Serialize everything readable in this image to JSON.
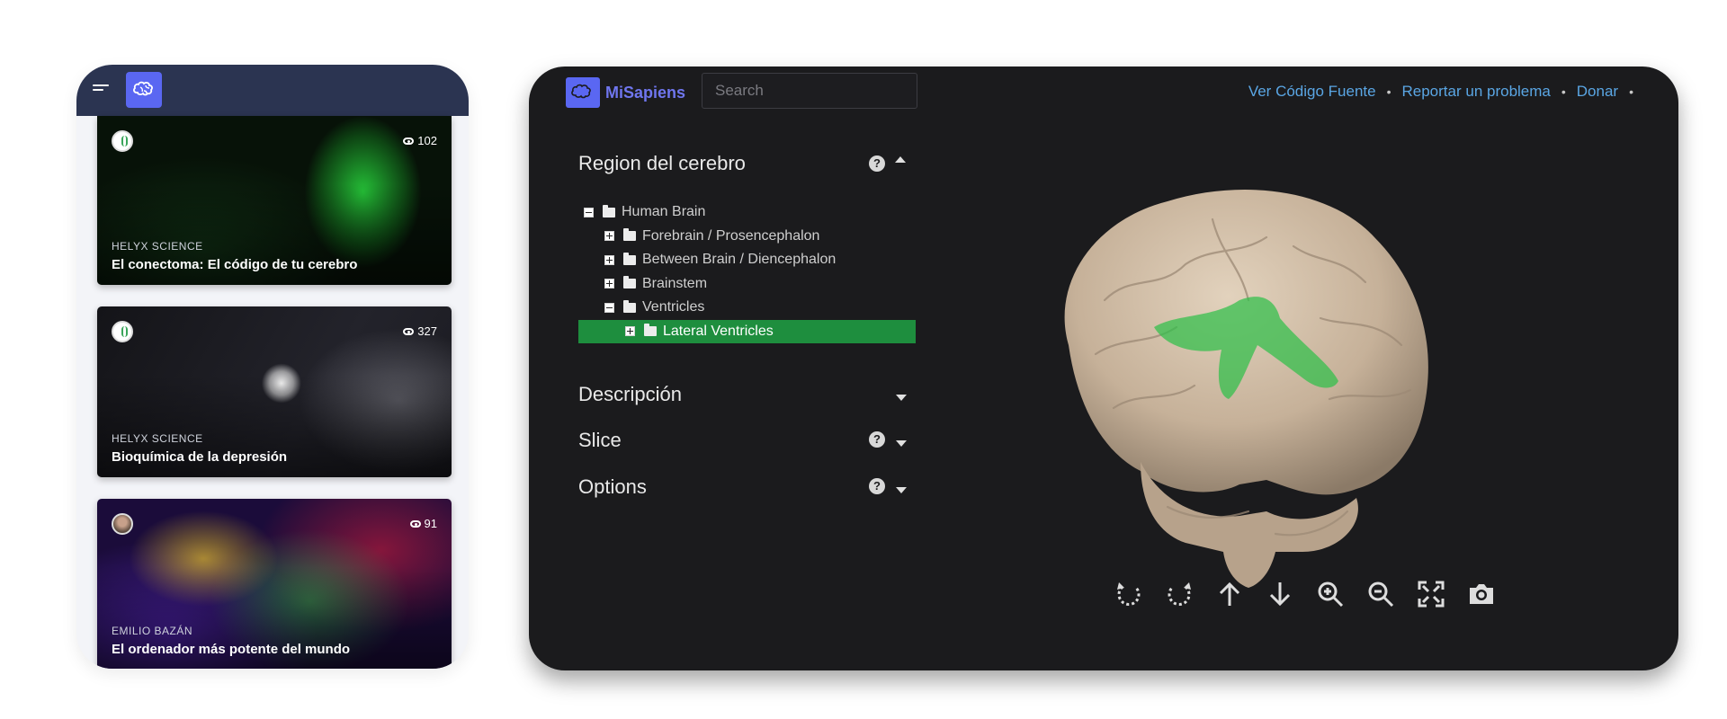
{
  "mobile": {
    "cards": [
      {
        "author": "HELYX SCIENCE",
        "title": "El conectoma: El código de tu cerebro",
        "views": "102",
        "avatar_icon": "dna-icon"
      },
      {
        "author": "HELYX SCIENCE",
        "title": "Bioquímica de la depresión",
        "views": "327",
        "avatar_icon": "dna-icon"
      },
      {
        "author": "EMILIO BAZÁN",
        "title": "El ordenador más potente del mundo",
        "views": "91",
        "avatar_icon": "user-photo"
      }
    ]
  },
  "app": {
    "brand": "MiSapiens",
    "search": {
      "placeholder": "Search",
      "value": ""
    },
    "nav": [
      "Ver Código Fuente",
      "Reportar un problema",
      "Donar"
    ],
    "panels": {
      "region": "Region del cerebro",
      "description": "Descripción",
      "slice": "Slice",
      "options": "Options"
    },
    "tree": [
      {
        "label": "Human Brain",
        "level": 0,
        "toggle": "minus"
      },
      {
        "label": "Forebrain / Prosencephalon",
        "level": 1,
        "toggle": "plus"
      },
      {
        "label": "Between Brain / Diencephalon",
        "level": 1,
        "toggle": "plus"
      },
      {
        "label": "Brainstem",
        "level": 1,
        "toggle": "plus"
      },
      {
        "label": "Ventricles",
        "level": 1,
        "toggle": "minus"
      },
      {
        "label": "Lateral Ventricles",
        "level": 2,
        "toggle": "plus",
        "selected": true
      }
    ],
    "toolbar": [
      "rotate-left-icon",
      "rotate-right-icon",
      "arrow-up-icon",
      "arrow-down-icon",
      "zoom-in-icon",
      "zoom-out-icon",
      "fullscreen-icon",
      "camera-icon"
    ],
    "colors": {
      "accent": "#5a67f2",
      "selected": "#1e8e3e",
      "link": "#5aa6e4",
      "brain": "#c9b49c",
      "ventricles": "#2fbf4a"
    }
  }
}
